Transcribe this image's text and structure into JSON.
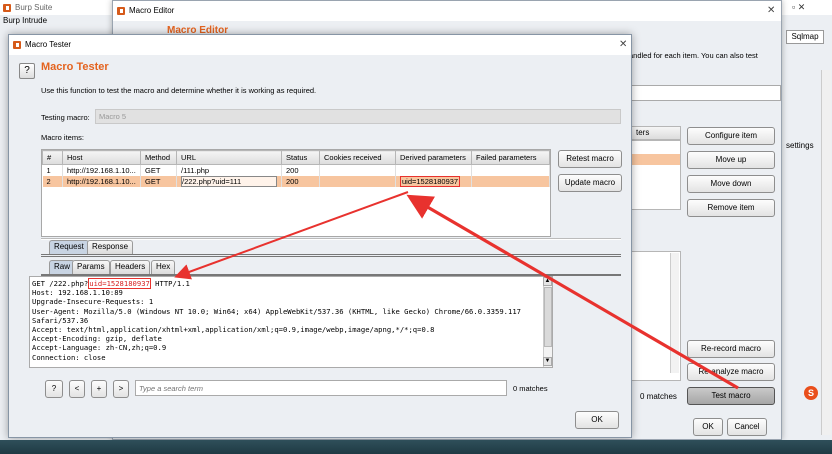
{
  "bg_window": {
    "title": "Burp Suite",
    "menu_item": "Burp  Intrude",
    "tab_sqlmap": "Sqlmap",
    "text_handled": "andled for each item. You can also test",
    "text_settings": "settings",
    "text_matches": "0 matches",
    "right_partial": "ters"
  },
  "macro_editor": {
    "title": "Macro Editor",
    "header": "Macro Editor",
    "buttons": {
      "configure": "Configure item",
      "move_up": "Move up",
      "move_down": "Move down",
      "remove": "Remove item",
      "rerecord": "Re-record macro",
      "reanalyze": "Re-analyze macro",
      "test": "Test macro",
      "ok": "OK",
      "cancel": "Cancel"
    },
    "close_glyph": "✕"
  },
  "macro_tester": {
    "title": "Macro Tester",
    "header": "Macro Tester",
    "help_glyph": "?",
    "description": "Use this function to test the macro and determine whether it is working as required.",
    "testing_label": "Testing macro:",
    "testing_value": "Macro 5",
    "items_label": "Macro items:",
    "close_glyph": "✕",
    "columns": [
      "#",
      "Host",
      "Method",
      "URL",
      "Status",
      "Cookies received",
      "Derived parameters",
      "Failed parameters"
    ],
    "rows": [
      [
        "1",
        "http://192.168.1.10...",
        "GET",
        "/111.php",
        "200",
        "",
        "",
        ""
      ],
      [
        "2",
        "http://192.168.1.10...",
        "GET",
        "/222.php?uid=111",
        "200",
        "",
        "uid=1528180937",
        ""
      ]
    ],
    "retest_btn": "Retest macro",
    "update_btn": "Update macro",
    "req_tabs": {
      "request": "Request",
      "response": "Response"
    },
    "sub_tabs": {
      "raw": "Raw",
      "params": "Params",
      "headers": "Headers",
      "hex": "Hex"
    },
    "request_lines": {
      "l1_a": "GET /222.php?",
      "l1_b": "uid=1528180937",
      "l1_c": " HTTP/1.1",
      "l2": "Host: 192.168.1.10:89",
      "l3": "Upgrade-Insecure-Requests: 1",
      "l4": "User-Agent: Mozilla/5.0 (Windows NT 10.0; Win64; x64) AppleWebKit/537.36 (KHTML, like Gecko) Chrome/66.0.3359.117",
      "l5": "Safari/537.36",
      "l6": "Accept: text/html,application/xhtml+xml,application/xml;q=0.9,image/webp,image/apng,*/*;q=0.8",
      "l7": "Accept-Encoding: gzip, deflate",
      "l8": "Accept-Language: zh-CN,zh;q=0.9",
      "l9": "Connection: close"
    },
    "search_buttons": [
      "?",
      "<",
      "+",
      ">"
    ],
    "search_placeholder": "Type a search term",
    "matches": "0 matches",
    "ok": "OK"
  },
  "colors": {
    "accent": "#e4631f",
    "highlight_row": "#f7c59f",
    "annotation": "#e8322e"
  }
}
